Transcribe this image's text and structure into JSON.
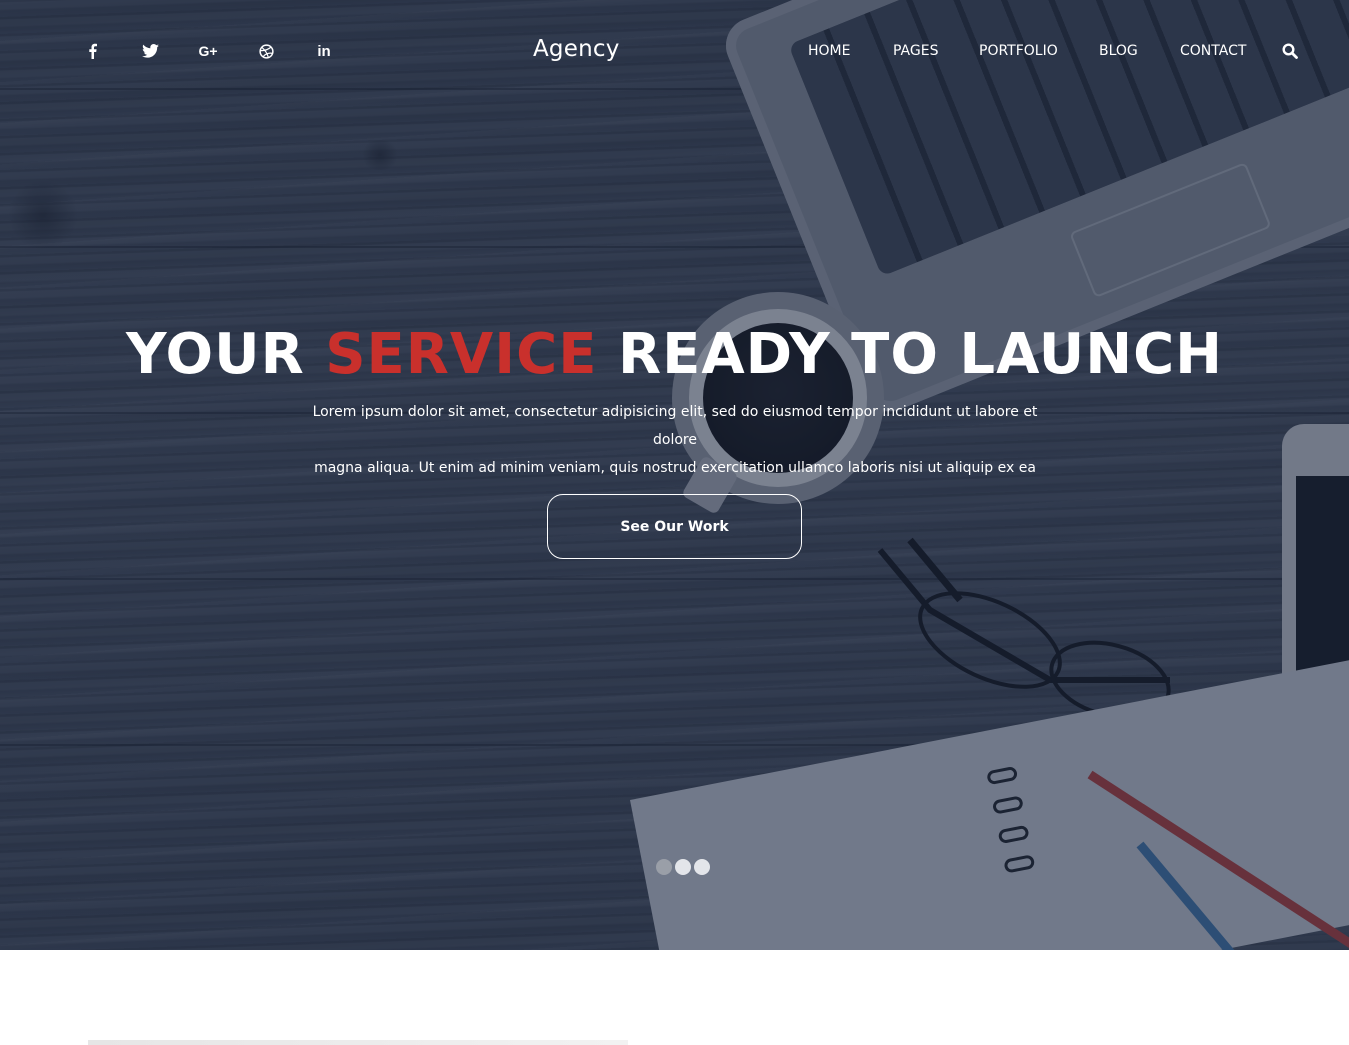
{
  "header": {
    "logo": "Agency",
    "social": [
      {
        "icon": "facebook-icon",
        "glyph": "f"
      },
      {
        "icon": "twitter-icon"
      },
      {
        "icon": "google-plus-icon",
        "glyph": "G+"
      },
      {
        "icon": "dribbble-icon"
      },
      {
        "icon": "linkedin-icon",
        "glyph": "in"
      }
    ],
    "nav": [
      {
        "label": "HOME"
      },
      {
        "label": "PAGES"
      },
      {
        "label": "PORTFOLIO"
      },
      {
        "label": "BLOG"
      },
      {
        "label": "CONTACT"
      }
    ],
    "search_icon": "search-icon"
  },
  "hero": {
    "headline_part1": "YOUR",
    "headline_accent": "SERVICE",
    "headline_part2": "READY TO LAUNCH",
    "subtext_line1": "Lorem ipsum dolor sit amet, consectetur adipisicing elit, sed do eiusmod tempor incididunt ut labore et dolore",
    "subtext_line2": "magna aliqua. Ut enim ad minim veniam, quis nostrud exercitation ullamco laboris nisi ut aliquip ex ea",
    "cta_label": "See Our Work",
    "slides_total": 3,
    "active_slide": 1
  },
  "colors": {
    "accent": "#c9302c",
    "overlay": "#1c2840",
    "text": "#ffffff"
  }
}
